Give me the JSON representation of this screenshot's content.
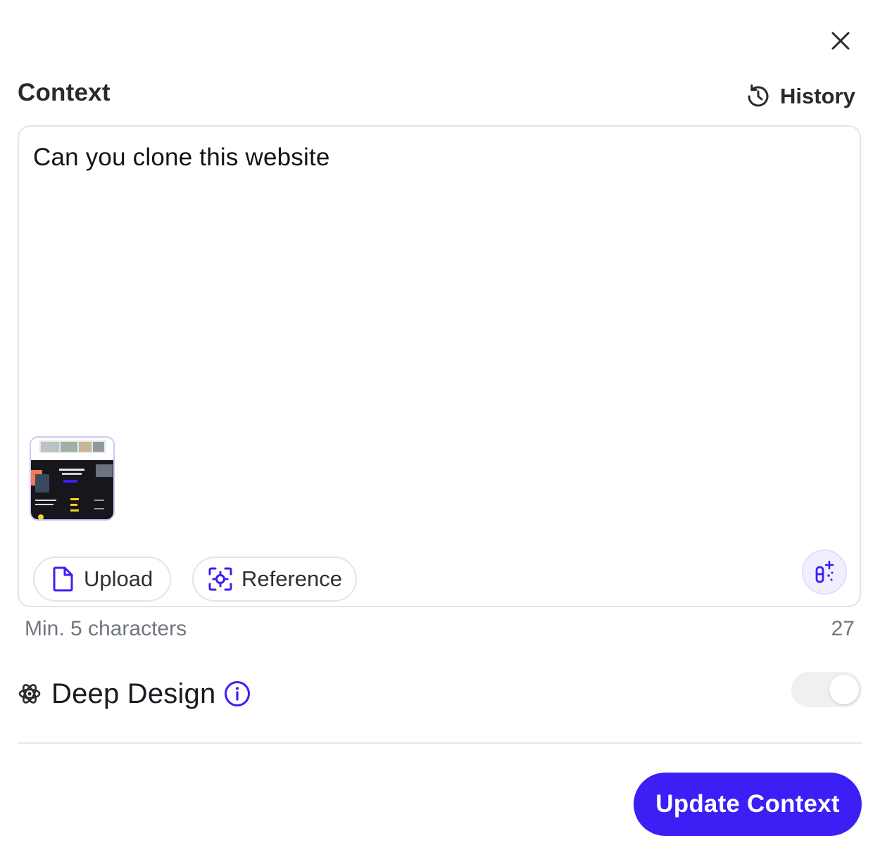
{
  "header": {
    "title": "Context",
    "history_label": "History"
  },
  "editor": {
    "text": "Can you clone this website",
    "upload_label": "Upload",
    "reference_label": "Reference"
  },
  "footer_info": {
    "hint": "Min. 5 characters",
    "char_count": "27"
  },
  "deep_design": {
    "label": "Deep Design",
    "enabled": false
  },
  "actions": {
    "primary_label": "Update Context"
  },
  "colors": {
    "accent": "#3b1ff5",
    "accent_soft": "#f1efff"
  },
  "icons": {
    "close": "close-icon",
    "history": "history-icon",
    "upload": "file-icon",
    "reference": "target-scan-icon",
    "magic": "magic-wand-icon",
    "deep_design": "atom-icon",
    "info": "info-icon"
  }
}
